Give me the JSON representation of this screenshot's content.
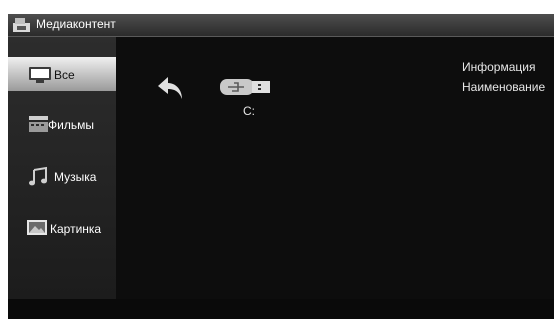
{
  "window": {
    "title": "Медиаконтент"
  },
  "sidebar": {
    "items": [
      {
        "label": "Все",
        "icon": "monitor-icon",
        "active": true
      },
      {
        "label": "Фильмы",
        "icon": "film-icon"
      },
      {
        "label": "Музыка",
        "icon": "music-note-icon"
      },
      {
        "label": "Картинка",
        "icon": "picture-icon"
      }
    ]
  },
  "main": {
    "back_icon": "back-arrow-icon",
    "drive": {
      "icon": "usb-drive-icon",
      "label": "C:"
    }
  },
  "info_panel": {
    "heading": "Информация",
    "name_label": "Наименование"
  }
}
